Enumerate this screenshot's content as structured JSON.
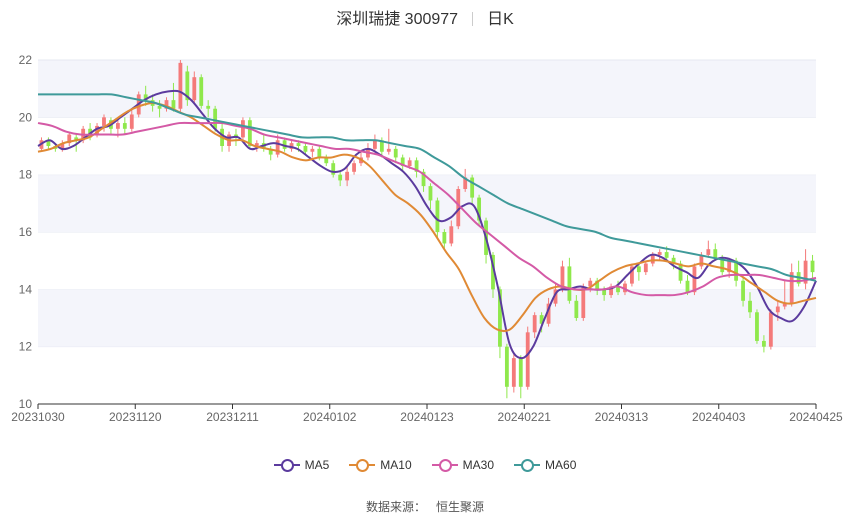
{
  "header": {
    "stock_name": "深圳瑞捷 300977",
    "period": "日K"
  },
  "footer": {
    "source_label": "数据来源：",
    "source_name": "恒生聚源"
  },
  "colors": {
    "up": "#f47a7a",
    "down": "#8fe84c",
    "grid_band": "#f4f5fb",
    "MA5": "#5b3b9e",
    "MA10": "#e08a35",
    "MA30": "#d45aa6",
    "MA60": "#3f9a9a"
  },
  "chart_data": {
    "type": "candlestick",
    "y_ticks": [
      "10",
      "12",
      "14",
      "16",
      "18",
      "20",
      "22"
    ],
    "ylim": [
      10,
      22
    ],
    "x_tick_labels": [
      "20231030",
      "20231120",
      "20231211",
      "20240102",
      "20240123",
      "20240221",
      "20240313",
      "20240403",
      "20240425"
    ],
    "grid": true,
    "legend_position": "bottom",
    "legend": [
      "MA5",
      "MA10",
      "MA30",
      "MA60"
    ],
    "candles": [
      [
        18.9,
        19.2,
        19.3,
        18.8
      ],
      [
        19.2,
        19.0,
        19.3,
        18.9
      ],
      [
        19.0,
        18.9,
        19.1,
        18.8
      ],
      [
        18.9,
        19.1,
        19.2,
        18.8
      ],
      [
        19.1,
        19.4,
        19.5,
        19.0
      ],
      [
        19.3,
        19.2,
        19.4,
        18.8
      ],
      [
        19.2,
        19.6,
        19.7,
        19.1
      ],
      [
        19.6,
        19.3,
        19.8,
        19.2
      ],
      [
        19.4,
        19.7,
        19.8,
        19.3
      ],
      [
        19.7,
        20.0,
        20.1,
        19.5
      ],
      [
        19.9,
        19.6,
        20.0,
        19.4
      ],
      [
        19.6,
        19.8,
        19.9,
        19.3
      ],
      [
        19.8,
        19.6,
        20.0,
        19.4
      ],
      [
        19.6,
        20.1,
        20.3,
        19.5
      ],
      [
        20.1,
        20.8,
        20.9,
        20.0
      ],
      [
        20.8,
        20.6,
        21.1,
        20.4
      ],
      [
        20.6,
        20.4,
        20.8,
        20.2
      ],
      [
        20.4,
        20.3,
        20.6,
        20.0
      ],
      [
        20.3,
        20.6,
        20.7,
        20.2
      ],
      [
        20.6,
        20.3,
        21.2,
        20.2
      ],
      [
        20.3,
        21.9,
        22.0,
        20.2
      ],
      [
        21.6,
        20.6,
        21.8,
        20.4
      ],
      [
        20.6,
        21.4,
        21.6,
        20.5
      ],
      [
        21.4,
        20.4,
        21.5,
        20.3
      ],
      [
        20.4,
        20.3,
        20.6,
        20.0
      ],
      [
        20.3,
        19.6,
        20.4,
        19.5
      ],
      [
        19.6,
        19.0,
        19.8,
        18.8
      ],
      [
        19.0,
        19.4,
        19.5,
        18.8
      ],
      [
        19.4,
        19.3,
        19.6,
        19.0
      ],
      [
        19.3,
        19.9,
        20.0,
        19.2
      ],
      [
        19.9,
        19.0,
        20.0,
        18.9
      ],
      [
        19.0,
        19.1,
        19.2,
        18.8
      ],
      [
        19.1,
        18.9,
        19.4,
        18.8
      ],
      [
        18.9,
        18.7,
        19.0,
        18.5
      ],
      [
        18.7,
        19.2,
        19.4,
        18.6
      ],
      [
        19.2,
        18.9,
        19.3,
        18.8
      ],
      [
        18.9,
        19.1,
        19.2,
        18.8
      ],
      [
        19.1,
        19.0,
        19.2,
        18.8
      ],
      [
        19.0,
        18.8,
        19.1,
        18.7
      ],
      [
        18.8,
        18.9,
        19.0,
        18.6
      ],
      [
        18.9,
        18.6,
        19.0,
        18.5
      ],
      [
        18.6,
        18.4,
        18.7,
        18.3
      ],
      [
        18.4,
        18.0,
        18.5,
        17.9
      ],
      [
        18.0,
        17.8,
        18.1,
        17.6
      ],
      [
        17.8,
        18.1,
        18.3,
        17.6
      ],
      [
        18.1,
        18.4,
        18.5,
        18.0
      ],
      [
        18.4,
        18.6,
        18.8,
        18.3
      ],
      [
        18.6,
        18.9,
        19.1,
        18.5
      ],
      [
        18.9,
        19.2,
        19.4,
        18.8
      ],
      [
        19.2,
        18.8,
        19.3,
        18.6
      ],
      [
        18.8,
        18.9,
        19.6,
        18.7
      ],
      [
        18.9,
        18.6,
        19.0,
        18.4
      ],
      [
        18.6,
        18.3,
        18.7,
        18.1
      ],
      [
        18.3,
        18.5,
        18.6,
        18.2
      ],
      [
        18.5,
        18.1,
        18.6,
        17.9
      ],
      [
        18.1,
        17.6,
        18.2,
        17.4
      ],
      [
        17.6,
        17.1,
        17.7,
        16.8
      ],
      [
        17.1,
        16.0,
        17.2,
        15.8
      ],
      [
        16.0,
        15.6,
        16.1,
        15.4
      ],
      [
        15.6,
        16.2,
        16.4,
        15.5
      ],
      [
        16.2,
        17.5,
        17.6,
        16.1
      ],
      [
        17.5,
        17.9,
        18.2,
        17.4
      ],
      [
        17.9,
        17.2,
        18.0,
        17.0
      ],
      [
        17.2,
        16.4,
        17.3,
        16.2
      ],
      [
        16.4,
        15.2,
        16.5,
        14.9
      ],
      [
        15.2,
        14.0,
        15.3,
        13.7
      ],
      [
        14.0,
        12.0,
        14.1,
        11.6
      ],
      [
        12.0,
        10.6,
        12.1,
        10.2
      ],
      [
        10.6,
        11.6,
        11.8,
        10.4
      ],
      [
        11.6,
        10.6,
        11.7,
        10.2
      ],
      [
        10.6,
        12.5,
        12.7,
        10.5
      ],
      [
        12.5,
        13.1,
        13.2,
        12.3
      ],
      [
        13.1,
        12.8,
        13.2,
        12.5
      ],
      [
        12.8,
        13.5,
        13.7,
        12.7
      ],
      [
        13.5,
        14.0,
        14.2,
        13.4
      ],
      [
        14.0,
        14.8,
        15.0,
        13.9
      ],
      [
        14.8,
        13.6,
        15.1,
        13.5
      ],
      [
        13.6,
        13.0,
        13.8,
        12.9
      ],
      [
        13.0,
        14.1,
        14.2,
        12.9
      ],
      [
        14.1,
        14.3,
        14.4,
        13.9
      ],
      [
        14.3,
        14.0,
        14.4,
        13.8
      ],
      [
        14.0,
        13.8,
        14.1,
        13.6
      ],
      [
        13.8,
        14.1,
        14.2,
        13.7
      ],
      [
        14.1,
        13.9,
        14.3,
        13.8
      ],
      [
        13.9,
        14.2,
        14.3,
        13.8
      ],
      [
        14.2,
        14.8,
        14.9,
        14.1
      ],
      [
        14.8,
        14.6,
        14.9,
        14.3
      ],
      [
        14.6,
        14.9,
        15.0,
        14.5
      ],
      [
        14.9,
        15.2,
        15.3,
        14.8
      ],
      [
        15.2,
        15.3,
        15.4,
        15.0
      ],
      [
        15.3,
        15.1,
        15.5,
        15.0
      ],
      [
        15.1,
        14.9,
        15.2,
        14.7
      ],
      [
        14.9,
        14.3,
        15.0,
        14.2
      ],
      [
        14.3,
        13.9,
        14.5,
        13.8
      ],
      [
        13.9,
        14.8,
        14.9,
        13.8
      ],
      [
        14.8,
        15.2,
        15.3,
        14.7
      ],
      [
        15.2,
        15.4,
        15.7,
        15.1
      ],
      [
        15.4,
        15.1,
        15.6,
        15.0
      ],
      [
        15.1,
        14.6,
        15.2,
        14.5
      ],
      [
        14.6,
        15.0,
        15.1,
        14.4
      ],
      [
        15.0,
        14.3,
        15.1,
        14.1
      ],
      [
        14.3,
        13.6,
        14.4,
        13.4
      ],
      [
        13.6,
        13.2,
        13.9,
        13.0
      ],
      [
        13.2,
        12.2,
        13.3,
        12.1
      ],
      [
        12.2,
        12.0,
        12.4,
        11.8
      ],
      [
        12.0,
        13.2,
        13.3,
        11.9
      ],
      [
        13.2,
        13.4,
        13.6,
        12.9
      ],
      [
        13.4,
        13.5,
        14.3,
        13.3
      ],
      [
        13.5,
        14.6,
        14.9,
        13.4
      ],
      [
        14.6,
        14.2,
        15.0,
        14.1
      ],
      [
        14.2,
        15.0,
        15.4,
        14.0
      ],
      [
        15.0,
        14.6,
        15.2,
        14.4
      ]
    ],
    "series": [
      {
        "name": "MA5",
        "values": [
          19.0,
          19.2,
          18.9,
          19.0,
          19.3,
          19.6,
          19.7,
          20.0,
          20.3,
          20.6,
          20.8,
          20.9,
          20.9,
          20.6,
          20.1,
          19.6,
          19.3,
          19.3,
          18.9,
          19.0,
          19.1,
          19.0,
          18.9,
          18.6,
          18.3,
          18.1,
          18.2,
          18.7,
          18.9,
          18.7,
          18.4,
          18.1,
          17.6,
          16.9,
          16.4,
          16.5,
          16.9,
          16.9,
          15.8,
          14.1,
          12.1,
          11.6,
          12.0,
          13.0,
          13.9,
          14.0,
          14.1,
          14.0,
          14.0,
          14.1,
          14.5,
          14.9,
          15.2,
          15.1,
          14.8,
          14.6,
          14.4,
          14.9,
          15.1,
          15.0,
          14.7,
          14.1,
          13.3,
          13.0,
          12.9,
          13.4,
          14.3
        ]
      },
      {
        "name": "MA10",
        "values": [
          18.8,
          18.9,
          19.1,
          19.2,
          19.3,
          19.6,
          19.9,
          20.2,
          20.4,
          20.5,
          20.4,
          20.2,
          20.0,
          19.7,
          19.4,
          19.2,
          19.2,
          19.0,
          18.9,
          18.8,
          18.6,
          18.5,
          18.6,
          18.6,
          18.7,
          18.6,
          18.3,
          17.8,
          17.3,
          17.0,
          16.6,
          16.0,
          15.3,
          14.7,
          13.8,
          13.0,
          12.6,
          12.6,
          13.1,
          13.7,
          14.0,
          14.1,
          14.0,
          14.0,
          14.3,
          14.6,
          14.8,
          14.9,
          15.0,
          15.0,
          14.9,
          14.8,
          14.9,
          14.8,
          14.7,
          14.5,
          14.2,
          13.9,
          13.6,
          13.5,
          13.6,
          13.7
        ]
      },
      {
        "name": "MA30",
        "values": [
          19.8,
          19.7,
          19.5,
          19.4,
          19.4,
          19.4,
          19.4,
          19.5,
          19.6,
          19.7,
          19.8,
          19.8,
          19.8,
          19.8,
          19.7,
          19.6,
          19.4,
          19.3,
          19.2,
          19.1,
          19.0,
          18.9,
          18.9,
          18.8,
          18.7,
          18.5,
          18.3,
          18.1,
          17.7,
          17.3,
          16.8,
          16.3,
          15.9,
          15.5,
          15.1,
          14.8,
          14.4,
          14.1,
          14.0,
          14.0,
          14.0,
          14.1,
          13.9,
          13.8,
          13.8,
          13.8,
          13.9,
          14.1,
          14.4,
          14.5,
          14.5,
          14.5,
          14.4,
          14.3,
          14.3,
          14.4
        ]
      },
      {
        "name": "MA60",
        "values": [
          20.8,
          20.8,
          20.8,
          20.8,
          20.8,
          20.8,
          20.7,
          20.6,
          20.5,
          20.3,
          20.1,
          20.0,
          19.9,
          19.8,
          19.7,
          19.6,
          19.5,
          19.4,
          19.3,
          19.3,
          19.3,
          19.2,
          19.2,
          19.2,
          19.1,
          19.0,
          18.9,
          18.6,
          18.3,
          17.9,
          17.6,
          17.3,
          17.0,
          16.8,
          16.6,
          16.4,
          16.2,
          16.1,
          16.0,
          15.8,
          15.7,
          15.6,
          15.5,
          15.4,
          15.3,
          15.2,
          15.1,
          15.0,
          14.9,
          14.8,
          14.7,
          14.5,
          14.4,
          14.3
        ]
      }
    ]
  }
}
